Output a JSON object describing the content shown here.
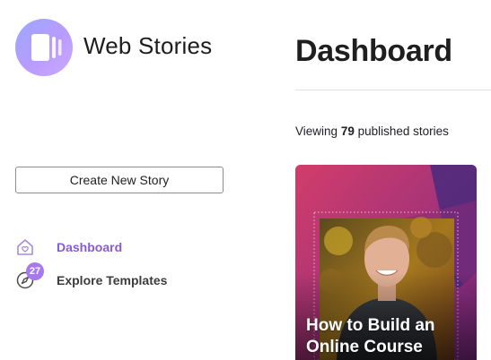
{
  "brand": {
    "name": "Web Stories",
    "logo_icon": "web-stories-logo-icon"
  },
  "sidebar": {
    "create_button_label": "Create New Story",
    "nav": [
      {
        "label": "Dashboard",
        "icon": "home-icon",
        "active": true,
        "color": "#8a5ad6"
      },
      {
        "label": "Explore Templates",
        "icon": "compass-icon",
        "badge": "27",
        "badge_color": "#a779f1"
      }
    ]
  },
  "main": {
    "title": "Dashboard",
    "viewing_prefix": "Viewing",
    "published_count": "79",
    "viewing_suffix": "published stories"
  },
  "stories": [
    {
      "title": "How to Build an Online Course"
    }
  ],
  "colors": {
    "accent": "#8a5ad6",
    "badge": "#a779f1"
  }
}
